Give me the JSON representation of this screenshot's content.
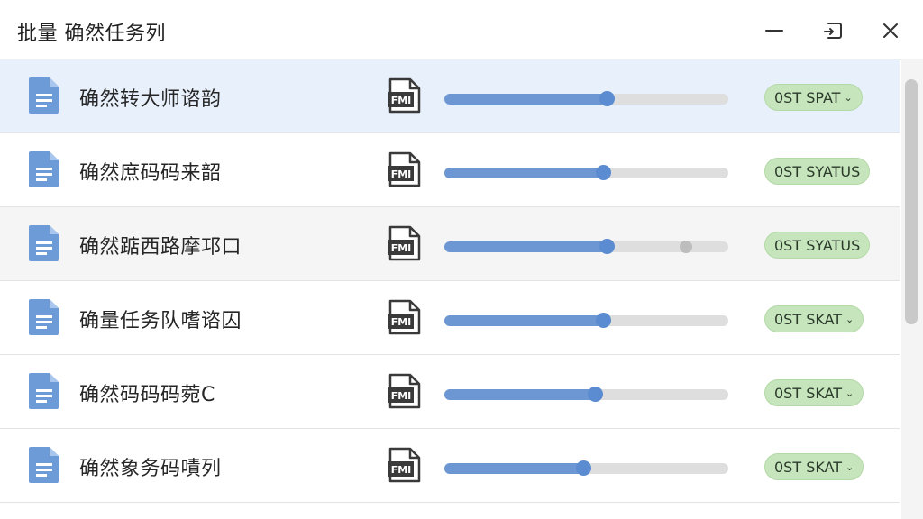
{
  "window": {
    "title": "批量 确然任务列"
  },
  "rows": [
    {
      "name": "确然转大师谘韵",
      "badge": "0ST SPAT",
      "has_chevron": true,
      "progress": 0.57
    },
    {
      "name": "确然庶码码来韶",
      "badge": "0ST SYATUS",
      "has_chevron": false,
      "progress": 0.56
    },
    {
      "name": "确然踮西路摩邛口",
      "badge": "0ST SYATUS",
      "has_chevron": false,
      "progress": 0.57
    },
    {
      "name": "确量任务队嗜谘囚",
      "badge": "0ST SKAT",
      "has_chevron": true,
      "progress": 0.56
    },
    {
      "name": "确然码码码菀C",
      "badge": "0ST SKAT",
      "has_chevron": true,
      "progress": 0.53
    },
    {
      "name": "确然象务码嘖列",
      "badge": "0ST SKAT",
      "has_chevron": true,
      "progress": 0.49
    }
  ],
  "icons": {
    "file": "document-icon",
    "fmi": "fmi-file-icon",
    "minimize": "minimize-icon",
    "restore": "restore-icon",
    "close": "close-icon"
  },
  "colors": {
    "accent": "#6c97d2",
    "badge_bg": "#c6e5bc",
    "selected_row": "#e8f0fc"
  }
}
